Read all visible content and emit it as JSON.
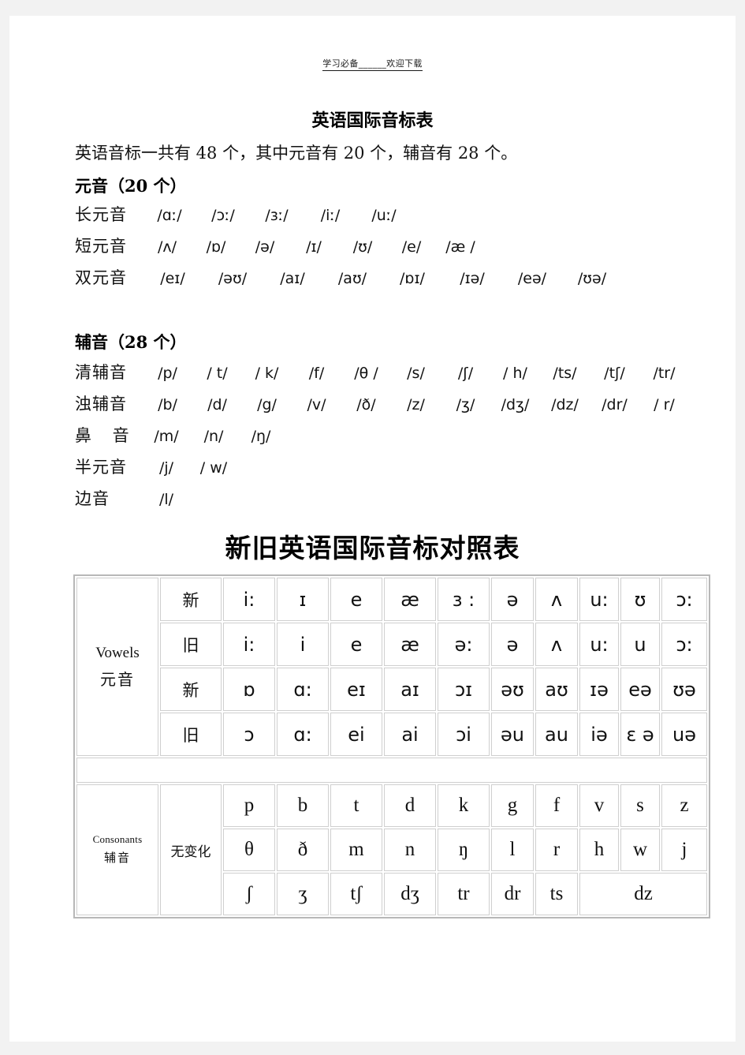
{
  "running_head": "学习必备______欢迎下载",
  "doc": {
    "title": "英语国际音标表",
    "intro": "英语音标一共有 48 个，其中元音有 20 个，辅音有 28 个。"
  },
  "vowels_section": {
    "heading": "元音（20 个）",
    "rows": [
      {
        "label": "长元音",
        "symbols": [
          "/ɑː/",
          "/ɔː/",
          "/ɜː/",
          "/iː/",
          "/uː/"
        ]
      },
      {
        "label": "短元音",
        "symbols": [
          "/ʌ/",
          "/ɒ/",
          "/ə/",
          "/ɪ/",
          "/ʊ/",
          "/e/",
          "/æ /"
        ]
      },
      {
        "label": "双元音",
        "symbols": [
          "/eɪ/",
          "/əʊ/",
          "/aɪ/",
          "/aʊ/",
          "/ɒɪ/",
          "/ɪə/",
          "/eə/",
          "/ʊə/"
        ]
      }
    ]
  },
  "consonants_section": {
    "heading": "辅音（28 个）",
    "rows": [
      {
        "label": "清辅音",
        "symbols": [
          "/p/",
          "/ t/",
          "/ k/",
          "/f/",
          "/θ /",
          "/s/",
          "/ʃ/",
          "/ h/",
          "/ts/",
          "/tʃ/",
          "/tr/"
        ]
      },
      {
        "label": "浊辅音",
        "symbols": [
          "/b/",
          "/d/",
          "/g/",
          "/v/",
          "/ð/",
          "/z/",
          "/ʒ/",
          "/dʒ/",
          "/dz/",
          "/dr/",
          "/ r/"
        ]
      },
      {
        "label": "鼻 音",
        "symbols": [
          "/m/",
          "/n/",
          "/ŋ/"
        ]
      },
      {
        "label": "半元音",
        "symbols": [
          "/j/",
          "/ w/"
        ]
      },
      {
        "label": "边音",
        "symbols": [
          "/l/"
        ]
      }
    ]
  },
  "comparison": {
    "title": "新旧英语国际音标对照表",
    "vowels_label_en": "Vowels",
    "vowels_label_cn": "元音",
    "consonants_label_en": "Consonants",
    "consonants_label_cn": "辅音",
    "new_label": "新",
    "old_label": "旧",
    "nochange_label": "无变化",
    "vowel_rows": [
      {
        "kind": "新",
        "cells": [
          "i:",
          "ɪ",
          "e",
          "æ",
          "ɜ :",
          "ə",
          "ʌ",
          "u:",
          "ʊ",
          "ɔ:"
        ]
      },
      {
        "kind": "旧",
        "cells": [
          "i:",
          "i",
          "e",
          "æ",
          "ə:",
          "ə",
          "ʌ",
          "u:",
          "u",
          "ɔ:"
        ]
      },
      {
        "kind": "新",
        "cells": [
          "ɒ",
          "ɑ:",
          "eɪ",
          "aɪ",
          "ɔɪ",
          "əʊ",
          "aʊ",
          "ɪə",
          "eə",
          "ʊə"
        ]
      },
      {
        "kind": "旧",
        "cells": [
          "ɔ",
          "ɑ:",
          "ei",
          "ai",
          "ɔi",
          "əu",
          "au",
          "iə",
          "ɛ ə",
          "uə"
        ]
      }
    ],
    "consonant_rows": [
      [
        "p",
        "b",
        "t",
        "d",
        "k",
        "g",
        "f",
        "v",
        "s",
        "z"
      ],
      [
        "θ",
        "ð",
        "m",
        "n",
        "ŋ",
        "l",
        "r",
        "h",
        "w",
        "j"
      ],
      [
        "ʃ",
        "ʒ",
        "tʃ",
        "dʒ",
        "tr",
        "dr",
        "ts",
        "dz"
      ]
    ]
  }
}
